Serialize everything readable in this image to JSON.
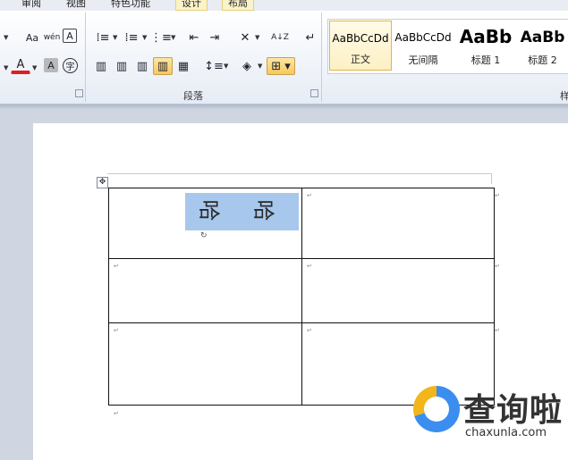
{
  "ribbon": {
    "tabs": [
      "审阅",
      "视图",
      "特色功能",
      "设计",
      "布局"
    ],
    "paragraph_label": "段落",
    "styles_label_partial": "样",
    "styles": [
      {
        "preview": "AaBbCcDd",
        "name": "正文"
      },
      {
        "preview": "AaBbCcDd",
        "name": "无间隔"
      },
      {
        "preview": "AaBb",
        "name": "标题 1"
      },
      {
        "preview": "AaBb",
        "name": "标题 2"
      }
    ],
    "icons": {
      "change_case": "Aa",
      "phonetic": "wén",
      "char_border": "A",
      "font_color": "A",
      "char_shading": "A",
      "enclose_char": "字",
      "sort": "A↓Z"
    }
  },
  "document": {
    "cell_text": [
      "哈",
      "哈"
    ]
  },
  "watermark": {
    "brand": "查询啦",
    "url": "chaxunla.com"
  },
  "colors": {
    "selection": "#a7c8ec",
    "font_color_red": "#e02020",
    "active_button": "#f7c85d"
  }
}
